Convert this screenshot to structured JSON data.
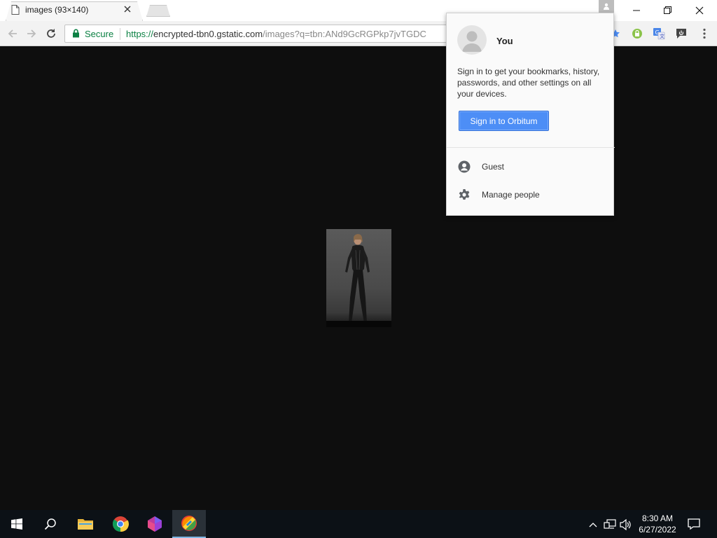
{
  "tab": {
    "title": "images (93×140)"
  },
  "omnibox": {
    "secure_label": "Secure",
    "url_scheme": "https://",
    "url_host": "encrypted-tbn0.gstatic.com",
    "url_rest": "/images?q=tbn:ANd9GcRGPkp7jvTGDC"
  },
  "popup": {
    "username": "You",
    "description": "Sign in to get your bookmarks, history, passwords, and other settings on all your devices.",
    "signin_button": "Sign in to Orbitum",
    "items": [
      {
        "label": "Guest",
        "icon": "guest-icon"
      },
      {
        "label": "Manage people",
        "icon": "gear-icon"
      }
    ]
  },
  "image": {
    "description_icon": "photo"
  },
  "taskbar": {
    "time": "8:30 AM",
    "date": "6/27/2022"
  },
  "colors": {
    "accent": "#4d8ef6",
    "secure": "#0b8043",
    "page_background": "#0e0e0e",
    "taskbar": "#0c1116"
  }
}
